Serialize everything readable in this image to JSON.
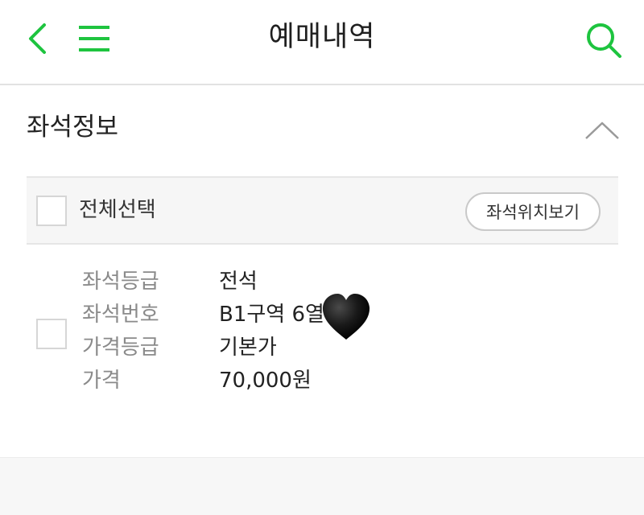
{
  "header": {
    "title": "예매내역",
    "icons": {
      "back": "chevron-left-icon",
      "menu": "hamburger-menu-icon",
      "search": "search-icon"
    },
    "accent_color": "#1ec43f"
  },
  "section": {
    "title": "좌석정보",
    "collapse_icon": "chevron-up-icon"
  },
  "select_bar": {
    "select_all_label": "전체선택",
    "seat_map_button": "좌석위치보기"
  },
  "seat": {
    "rows": [
      {
        "label": "좌석등급",
        "value": "전석"
      },
      {
        "label": "좌석번호",
        "value": "B1구역 6열"
      },
      {
        "label": "가격등급",
        "value": "기본가"
      },
      {
        "label": "가격",
        "value": "70,000원"
      }
    ],
    "sticker": "black-heart-icon"
  }
}
